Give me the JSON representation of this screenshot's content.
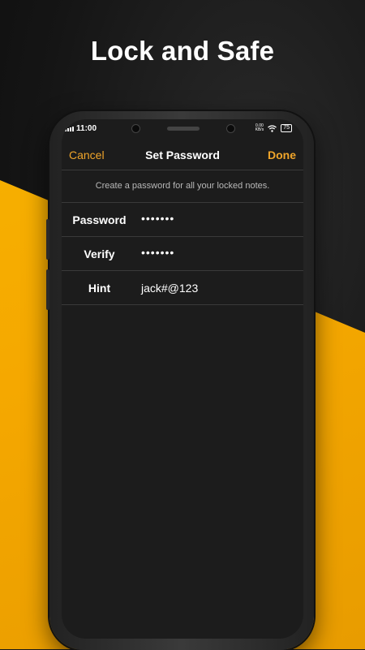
{
  "headline": "Lock and Safe",
  "status_bar": {
    "time": "11:00",
    "data_rate_value": "0.00",
    "data_rate_unit": "KB/s",
    "battery": "75"
  },
  "nav": {
    "cancel_label": "Cancel",
    "title": "Set Password",
    "done_label": "Done"
  },
  "description": "Create a password for all your locked notes.",
  "fields": {
    "password": {
      "label": "Password",
      "value": "•••••••"
    },
    "verify": {
      "label": "Verify",
      "value": "•••••••"
    },
    "hint": {
      "label": "Hint",
      "value": "jack#@123"
    }
  },
  "colors": {
    "accent": "#f0a52a",
    "yellow_background": "#f5a800",
    "screen_background": "#1c1c1c"
  }
}
